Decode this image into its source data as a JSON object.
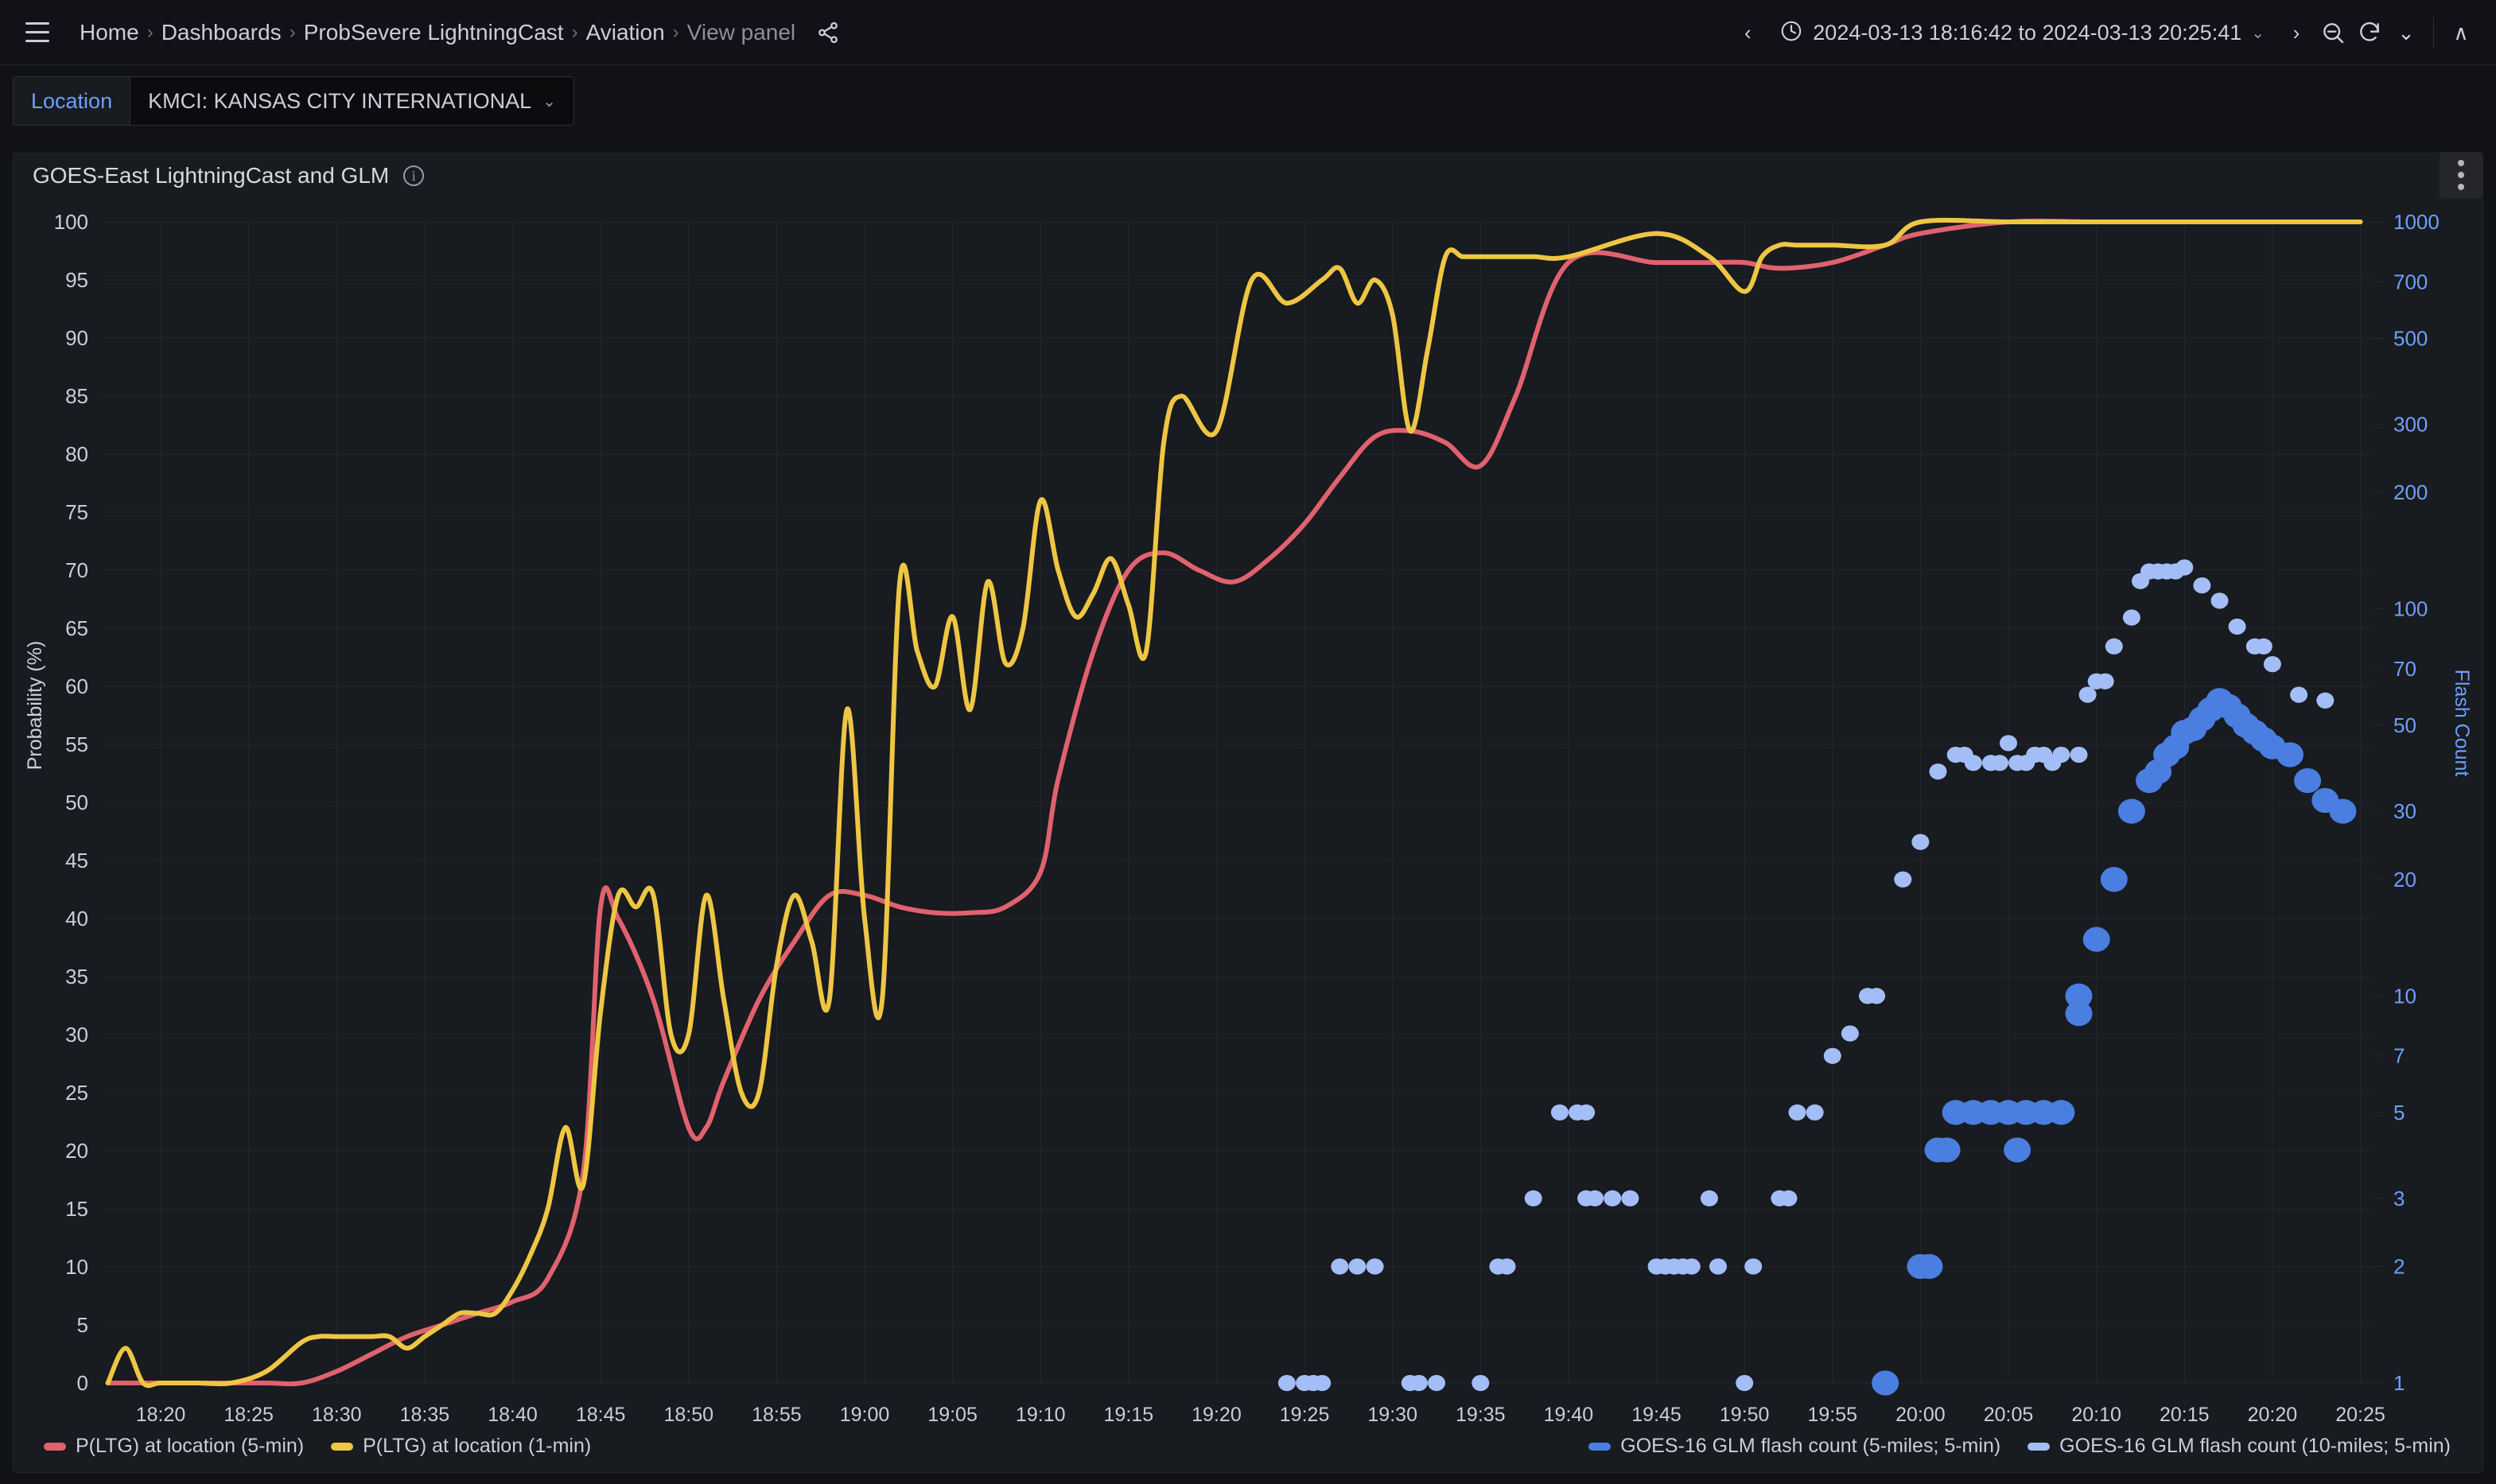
{
  "nav": {
    "menu_icon": "hamburger-icon",
    "breadcrumbs": [
      {
        "label": "Home",
        "active": true
      },
      {
        "label": "Dashboards",
        "active": true
      },
      {
        "label": "ProbSevere LightningCast",
        "active": true
      },
      {
        "label": "Aviation",
        "active": true
      },
      {
        "label": "View panel",
        "active": false
      }
    ],
    "separator": "›",
    "share_icon": "share-icon"
  },
  "timerange": {
    "prev_icon": "‹",
    "clock_icon": "clock-icon",
    "text": "2024-03-13 18:16:42 to 2024-03-13 20:25:41",
    "dropdown_icon": "⌄",
    "next_icon": "›",
    "zoom_out_icon": "zoom-out-icon",
    "refresh_icon": "refresh-icon",
    "refresh_dropdown_icon": "⌄",
    "collapse_icon": "∧"
  },
  "variables": {
    "location": {
      "label": "Location",
      "value": "KMCI: KANSAS CITY INTERNATIONAL",
      "caret": "⌄"
    }
  },
  "panel": {
    "title": "GOES-East LightningCast and GLM",
    "info_icon": "info-icon",
    "menu_icon": "panel-menu-icon"
  },
  "colors": {
    "red": "#e0626e",
    "yellow": "#eec643",
    "blue_light": "#a3bdf7",
    "blue_dark": "#4a7ee0",
    "axis_right": "#6e9fff",
    "text": "#ccccdc",
    "panel_bg": "#181b1f",
    "page_bg": "#111217",
    "grid": "#24262b"
  },
  "legend": {
    "left": [
      {
        "label": "P(LTG) at location (5-min)",
        "color": "#e0626e"
      },
      {
        "label": "P(LTG) at location (1-min)",
        "color": "#eec643"
      }
    ],
    "right": [
      {
        "label": "GOES-16 GLM flash count (5-miles; 5-min)",
        "color": "#4a7ee0"
      },
      {
        "label": "GOES-16 GLM flash count (10-miles; 5-min)",
        "color": "#a3bdf7"
      }
    ]
  },
  "chart_data": {
    "type": "line",
    "title": "GOES-East LightningCast and GLM",
    "xlabel": "",
    "ylabel": "Probability (%)",
    "y2label": "Flash Count",
    "grid": true,
    "legend_position": "bottom",
    "xlim": [
      "18:16:42",
      "20:25:41"
    ],
    "x_ticks": [
      "18:20",
      "18:25",
      "18:30",
      "18:35",
      "18:40",
      "18:45",
      "18:50",
      "18:55",
      "19:00",
      "19:05",
      "19:10",
      "19:15",
      "19:20",
      "19:25",
      "19:30",
      "19:35",
      "19:40",
      "19:45",
      "19:50",
      "19:55",
      "20:00",
      "20:05",
      "20:10",
      "20:15",
      "20:20",
      "20:25"
    ],
    "ylim": [
      0,
      100
    ],
    "y_ticks": [
      0,
      5,
      10,
      15,
      20,
      25,
      30,
      35,
      40,
      45,
      50,
      55,
      60,
      65,
      70,
      75,
      80,
      85,
      90,
      95,
      100
    ],
    "y2_scale": "log",
    "y2lim": [
      1,
      1000
    ],
    "y2_ticks": [
      1,
      2,
      3,
      5,
      7,
      10,
      20,
      30,
      50,
      70,
      100,
      200,
      300,
      500,
      700,
      1000
    ],
    "series": [
      {
        "name": "P(LTG) at location (5-min)",
        "color": "#e0626e",
        "axis": "left",
        "x": [
          "18:17",
          "18:20",
          "18:23",
          "18:26",
          "18:28",
          "18:30",
          "18:32",
          "18:34",
          "18:36",
          "18:38",
          "18:40",
          "18:42",
          "18:44",
          "18:45",
          "18:46",
          "18:48",
          "18:50",
          "18:51",
          "18:52",
          "18:54",
          "18:56",
          "18:58",
          "19:00",
          "19:02",
          "19:04",
          "19:06",
          "19:08",
          "19:10",
          "19:11",
          "19:13",
          "19:15",
          "19:17",
          "19:19",
          "19:21",
          "19:23",
          "19:25",
          "19:27",
          "19:29",
          "19:31",
          "19:33",
          "19:35",
          "19:37",
          "19:40",
          "19:45",
          "19:48",
          "19:50",
          "19:52",
          "19:55",
          "19:58",
          "20:00",
          "20:05",
          "20:10",
          "20:15",
          "20:20",
          "20:25"
        ],
        "y": [
          0,
          0,
          0,
          0,
          0,
          1,
          2.5,
          4,
          5,
          6,
          7,
          9,
          18,
          41,
          40,
          33,
          22,
          22,
          26,
          33,
          38,
          42,
          42,
          41,
          40.5,
          40.5,
          41,
          44,
          52,
          63,
          70,
          71.5,
          70,
          69,
          71,
          74,
          78,
          81.5,
          82,
          81,
          79,
          85,
          96.5,
          96.5,
          96.5,
          96.5,
          96,
          96.5,
          98,
          99,
          100,
          100,
          100,
          100,
          100
        ]
      },
      {
        "name": "P(LTG) at location (1-min)",
        "color": "#eec643",
        "axis": "left",
        "x": [
          "18:17",
          "18:18",
          "18:19",
          "18:20",
          "18:22",
          "18:24",
          "18:26",
          "18:28",
          "18:29",
          "18:30",
          "18:31",
          "18:32",
          "18:33",
          "18:34",
          "18:35",
          "18:36",
          "18:37",
          "18:38",
          "18:39",
          "18:40",
          "18:41",
          "18:42",
          "18:43",
          "18:44",
          "18:45",
          "18:46",
          "18:47",
          "18:48",
          "18:49",
          "18:50",
          "18:51",
          "18:52",
          "18:53",
          "18:54",
          "18:55",
          "18:56",
          "18:57",
          "18:58",
          "18:59",
          "19:00",
          "19:01",
          "19:02",
          "19:03",
          "19:04",
          "19:05",
          "19:06",
          "19:07",
          "19:08",
          "19:09",
          "19:10",
          "19:11",
          "19:12",
          "19:13",
          "19:14",
          "19:15",
          "19:16",
          "19:17",
          "19:18",
          "19:20",
          "19:22",
          "19:24",
          "19:26",
          "19:27",
          "19:28",
          "19:29",
          "19:30",
          "19:31",
          "19:32",
          "19:33",
          "19:34",
          "19:35",
          "19:36",
          "19:38",
          "19:40",
          "19:45",
          "19:48",
          "19:50",
          "19:51",
          "19:52",
          "19:53",
          "19:55",
          "19:58",
          "20:00",
          "20:05",
          "20:10",
          "20:15",
          "20:20",
          "20:25"
        ],
        "y": [
          0,
          3,
          0,
          0,
          0,
          0,
          1,
          3.5,
          4,
          4,
          4,
          4,
          4,
          3,
          4,
          5,
          6,
          6,
          6,
          8,
          11,
          15,
          22,
          17,
          32,
          42,
          41,
          42,
          30,
          30,
          42,
          33,
          25,
          25,
          36,
          42,
          38,
          33,
          58,
          40,
          33,
          69,
          63,
          60,
          66,
          58,
          69,
          62,
          65,
          76,
          70,
          66,
          68,
          71,
          67,
          63,
          81,
          85,
          82,
          95,
          93,
          95,
          96,
          93,
          95,
          92,
          82,
          89,
          97,
          97,
          97,
          97,
          97,
          97,
          99,
          97,
          94,
          97,
          98,
          98,
          98,
          98,
          100,
          100,
          100,
          100,
          100,
          100
        ]
      },
      {
        "name": "GOES-16 GLM flash count (5-miles; 5-min)",
        "color": "#4a7ee0",
        "axis": "right",
        "type": "scatter",
        "points": [
          {
            "x": "19:58",
            "y": 1
          },
          {
            "x": "20:00",
            "y": 2
          },
          {
            "x": "20:00.5",
            "y": 2
          },
          {
            "x": "20:02",
            "y": 5
          },
          {
            "x": "20:03",
            "y": 5
          },
          {
            "x": "20:04",
            "y": 5
          },
          {
            "x": "20:05",
            "y": 5
          },
          {
            "x": "20:06",
            "y": 5
          },
          {
            "x": "20:07",
            "y": 5
          },
          {
            "x": "20:08",
            "y": 5
          },
          {
            "x": "20:01",
            "y": 4
          },
          {
            "x": "20:01.5",
            "y": 4
          },
          {
            "x": "20:05.5",
            "y": 4
          },
          {
            "x": "20:09",
            "y": 10
          },
          {
            "x": "20:09",
            "y": 9
          },
          {
            "x": "20:10",
            "y": 14
          },
          {
            "x": "20:11",
            "y": 20
          },
          {
            "x": "20:12",
            "y": 30
          },
          {
            "x": "20:13",
            "y": 36
          },
          {
            "x": "20:13.5",
            "y": 38
          },
          {
            "x": "20:14",
            "y": 42
          },
          {
            "x": "20:14.5",
            "y": 44
          },
          {
            "x": "20:15",
            "y": 48
          },
          {
            "x": "20:15.5",
            "y": 49
          },
          {
            "x": "20:16",
            "y": 52
          },
          {
            "x": "20:16.5",
            "y": 55
          },
          {
            "x": "20:17",
            "y": 58
          },
          {
            "x": "20:17.5",
            "y": 56
          },
          {
            "x": "20:18",
            "y": 53
          },
          {
            "x": "20:18.5",
            "y": 50
          },
          {
            "x": "20:19",
            "y": 48
          },
          {
            "x": "20:19.5",
            "y": 46
          },
          {
            "x": "20:20",
            "y": 44
          },
          {
            "x": "20:21",
            "y": 42
          },
          {
            "x": "20:22",
            "y": 36
          },
          {
            "x": "20:23",
            "y": 32
          },
          {
            "x": "20:24",
            "y": 30
          }
        ]
      },
      {
        "name": "GOES-16 GLM flash count (10-miles; 5-min)",
        "color": "#a3bdf7",
        "axis": "right",
        "type": "scatter",
        "points": [
          {
            "x": "19:24",
            "y": 1
          },
          {
            "x": "19:25",
            "y": 1
          },
          {
            "x": "19:25.5",
            "y": 1
          },
          {
            "x": "19:26",
            "y": 1
          },
          {
            "x": "19:31",
            "y": 1
          },
          {
            "x": "19:31.5",
            "y": 1
          },
          {
            "x": "19:32.5",
            "y": 1
          },
          {
            "x": "19:35",
            "y": 1
          },
          {
            "x": "19:50",
            "y": 1
          },
          {
            "x": "19:27",
            "y": 2
          },
          {
            "x": "19:28",
            "y": 2
          },
          {
            "x": "19:29",
            "y": 2
          },
          {
            "x": "19:36",
            "y": 2
          },
          {
            "x": "19:36.5",
            "y": 2
          },
          {
            "x": "19:45",
            "y": 2
          },
          {
            "x": "19:45.5",
            "y": 2
          },
          {
            "x": "19:46",
            "y": 2
          },
          {
            "x": "19:46.5",
            "y": 2
          },
          {
            "x": "19:47",
            "y": 2
          },
          {
            "x": "19:48.5",
            "y": 2
          },
          {
            "x": "19:50.5",
            "y": 2
          },
          {
            "x": "19:38",
            "y": 3
          },
          {
            "x": "19:41",
            "y": 3
          },
          {
            "x": "19:41.5",
            "y": 3
          },
          {
            "x": "19:42.5",
            "y": 3
          },
          {
            "x": "19:43.5",
            "y": 3
          },
          {
            "x": "19:48",
            "y": 3
          },
          {
            "x": "19:52",
            "y": 3
          },
          {
            "x": "19:52.5",
            "y": 3
          },
          {
            "x": "19:39.5",
            "y": 5
          },
          {
            "x": "19:40.5",
            "y": 5
          },
          {
            "x": "19:41",
            "y": 5
          },
          {
            "x": "19:53",
            "y": 5
          },
          {
            "x": "19:54",
            "y": 5
          },
          {
            "x": "19:55",
            "y": 7
          },
          {
            "x": "19:56",
            "y": 8
          },
          {
            "x": "19:57",
            "y": 10
          },
          {
            "x": "19:57.5",
            "y": 10
          },
          {
            "x": "19:59",
            "y": 20
          },
          {
            "x": "20:00",
            "y": 25
          },
          {
            "x": "20:01",
            "y": 38
          },
          {
            "x": "20:02",
            "y": 42
          },
          {
            "x": "20:02.5",
            "y": 42
          },
          {
            "x": "20:03",
            "y": 40
          },
          {
            "x": "20:04",
            "y": 40
          },
          {
            "x": "20:04.5",
            "y": 40
          },
          {
            "x": "20:05",
            "y": 45
          },
          {
            "x": "20:05.5",
            "y": 40
          },
          {
            "x": "20:06",
            "y": 40
          },
          {
            "x": "20:06.5",
            "y": 42
          },
          {
            "x": "20:07",
            "y": 42
          },
          {
            "x": "20:07.5",
            "y": 40
          },
          {
            "x": "20:08",
            "y": 42
          },
          {
            "x": "20:09",
            "y": 42
          },
          {
            "x": "20:09.5",
            "y": 60
          },
          {
            "x": "20:10",
            "y": 65
          },
          {
            "x": "20:10.5",
            "y": 65
          },
          {
            "x": "20:11",
            "y": 80
          },
          {
            "x": "20:12",
            "y": 95
          },
          {
            "x": "20:12.5",
            "y": 118
          },
          {
            "x": "20:13",
            "y": 125
          },
          {
            "x": "20:13.5",
            "y": 125
          },
          {
            "x": "20:14",
            "y": 125
          },
          {
            "x": "20:14.5",
            "y": 125
          },
          {
            "x": "20:15",
            "y": 128
          },
          {
            "x": "20:16",
            "y": 115
          },
          {
            "x": "20:17",
            "y": 105
          },
          {
            "x": "20:18",
            "y": 90
          },
          {
            "x": "20:19",
            "y": 80
          },
          {
            "x": "20:19.5",
            "y": 80
          },
          {
            "x": "20:20",
            "y": 72
          },
          {
            "x": "20:21.5",
            "y": 60
          },
          {
            "x": "20:23",
            "y": 58
          }
        ]
      }
    ]
  }
}
